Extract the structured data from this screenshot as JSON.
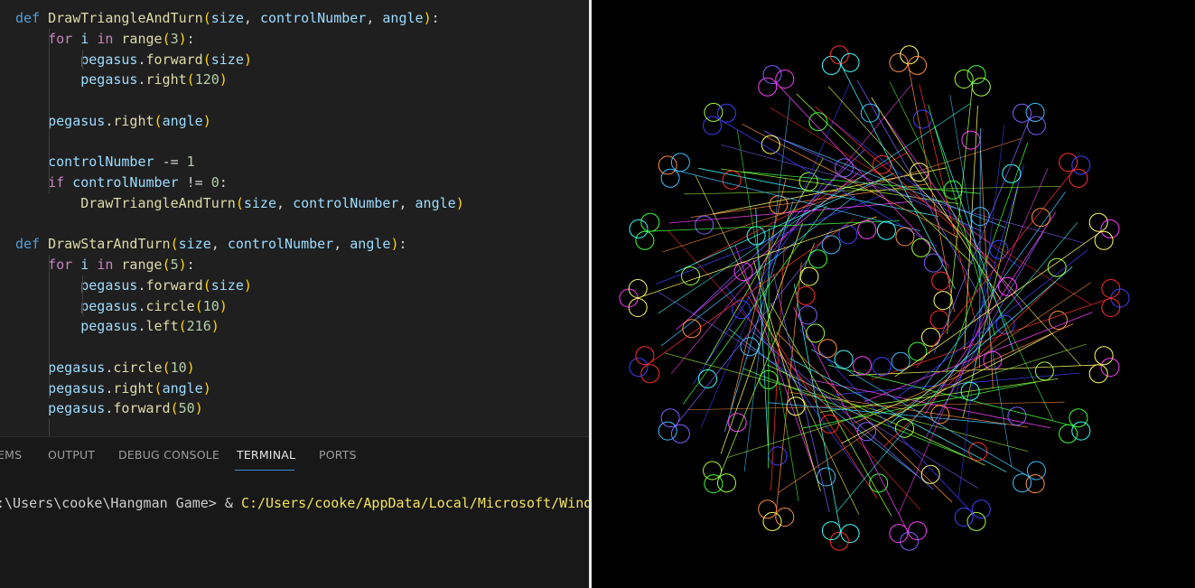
{
  "editor": {
    "lines": [
      [
        {
          "t": "def ",
          "c": "kw-def"
        },
        {
          "t": "DrawTriangleAndTurn",
          "c": "fn"
        },
        {
          "t": "(",
          "c": "br1"
        },
        {
          "t": "size",
          "c": "var"
        },
        {
          "t": ", ",
          "c": "pn"
        },
        {
          "t": "controlNumber",
          "c": "var"
        },
        {
          "t": ", ",
          "c": "pn"
        },
        {
          "t": "angle",
          "c": "var"
        },
        {
          "t": ")",
          "c": "br1"
        },
        {
          "t": ":",
          "c": "pn"
        }
      ],
      [
        {
          "t": "    "
        },
        {
          "t": "for ",
          "c": "kw-ctl"
        },
        {
          "t": "i ",
          "c": "var"
        },
        {
          "t": "in ",
          "c": "kw-ctl"
        },
        {
          "t": "range",
          "c": "fn"
        },
        {
          "t": "(",
          "c": "br1"
        },
        {
          "t": "3",
          "c": "num"
        },
        {
          "t": ")",
          "c": "br1"
        },
        {
          "t": ":",
          "c": "pn"
        }
      ],
      [
        {
          "t": "        "
        },
        {
          "t": "pegasus",
          "c": "var"
        },
        {
          "t": ".",
          "c": "pn"
        },
        {
          "t": "forward",
          "c": "fn"
        },
        {
          "t": "(",
          "c": "br1"
        },
        {
          "t": "size",
          "c": "var"
        },
        {
          "t": ")",
          "c": "br1"
        }
      ],
      [
        {
          "t": "        "
        },
        {
          "t": "pegasus",
          "c": "var"
        },
        {
          "t": ".",
          "c": "pn"
        },
        {
          "t": "right",
          "c": "fn"
        },
        {
          "t": "(",
          "c": "br1"
        },
        {
          "t": "120",
          "c": "num"
        },
        {
          "t": ")",
          "c": "br1"
        }
      ],
      [],
      [
        {
          "t": "    "
        },
        {
          "t": "pegasus",
          "c": "var"
        },
        {
          "t": ".",
          "c": "pn"
        },
        {
          "t": "right",
          "c": "fn"
        },
        {
          "t": "(",
          "c": "br1"
        },
        {
          "t": "angle",
          "c": "var"
        },
        {
          "t": ")",
          "c": "br1"
        }
      ],
      [],
      [
        {
          "t": "    "
        },
        {
          "t": "controlNumber ",
          "c": "var"
        },
        {
          "t": "-= ",
          "c": "op"
        },
        {
          "t": "1",
          "c": "num"
        }
      ],
      [
        {
          "t": "    "
        },
        {
          "t": "if ",
          "c": "kw-ctl"
        },
        {
          "t": "controlNumber ",
          "c": "var"
        },
        {
          "t": "!= ",
          "c": "op"
        },
        {
          "t": "0",
          "c": "num"
        },
        {
          "t": ":",
          "c": "pn"
        }
      ],
      [
        {
          "t": "        "
        },
        {
          "t": "DrawTriangleAndTurn",
          "c": "fn"
        },
        {
          "t": "(",
          "c": "br1"
        },
        {
          "t": "size",
          "c": "var"
        },
        {
          "t": ", ",
          "c": "pn"
        },
        {
          "t": "controlNumber",
          "c": "var"
        },
        {
          "t": ", ",
          "c": "pn"
        },
        {
          "t": "angle",
          "c": "var"
        },
        {
          "t": ")",
          "c": "br1"
        }
      ],
      [],
      [
        {
          "t": "def ",
          "c": "kw-def"
        },
        {
          "t": "DrawStarAndTurn",
          "c": "fn"
        },
        {
          "t": "(",
          "c": "br1"
        },
        {
          "t": "size",
          "c": "var"
        },
        {
          "t": ", ",
          "c": "pn"
        },
        {
          "t": "controlNumber",
          "c": "var"
        },
        {
          "t": ", ",
          "c": "pn"
        },
        {
          "t": "angle",
          "c": "var"
        },
        {
          "t": ")",
          "c": "br1"
        },
        {
          "t": ":",
          "c": "pn"
        }
      ],
      [
        {
          "t": "    "
        },
        {
          "t": "for ",
          "c": "kw-ctl"
        },
        {
          "t": "i ",
          "c": "var"
        },
        {
          "t": "in ",
          "c": "kw-ctl"
        },
        {
          "t": "range",
          "c": "fn"
        },
        {
          "t": "(",
          "c": "br1"
        },
        {
          "t": "5",
          "c": "num"
        },
        {
          "t": ")",
          "c": "br1"
        },
        {
          "t": ":",
          "c": "pn"
        }
      ],
      [
        {
          "t": "        "
        },
        {
          "t": "pegasus",
          "c": "var"
        },
        {
          "t": ".",
          "c": "pn"
        },
        {
          "t": "forward",
          "c": "fn"
        },
        {
          "t": "(",
          "c": "br1"
        },
        {
          "t": "size",
          "c": "var"
        },
        {
          "t": ")",
          "c": "br1"
        }
      ],
      [
        {
          "t": "        "
        },
        {
          "t": "pegasus",
          "c": "var"
        },
        {
          "t": ".",
          "c": "pn"
        },
        {
          "t": "circle",
          "c": "fn"
        },
        {
          "t": "(",
          "c": "br1"
        },
        {
          "t": "10",
          "c": "num"
        },
        {
          "t": ")",
          "c": "br1"
        }
      ],
      [
        {
          "t": "        "
        },
        {
          "t": "pegasus",
          "c": "var"
        },
        {
          "t": ".",
          "c": "pn"
        },
        {
          "t": "left",
          "c": "fn"
        },
        {
          "t": "(",
          "c": "br1"
        },
        {
          "t": "216",
          "c": "num"
        },
        {
          "t": ")",
          "c": "br1"
        }
      ],
      [],
      [
        {
          "t": "    "
        },
        {
          "t": "pegasus",
          "c": "var"
        },
        {
          "t": ".",
          "c": "pn"
        },
        {
          "t": "circle",
          "c": "fn"
        },
        {
          "t": "(",
          "c": "br1"
        },
        {
          "t": "10",
          "c": "num"
        },
        {
          "t": ")",
          "c": "br1"
        }
      ],
      [
        {
          "t": "    "
        },
        {
          "t": "pegasus",
          "c": "var"
        },
        {
          "t": ".",
          "c": "pn"
        },
        {
          "t": "right",
          "c": "fn"
        },
        {
          "t": "(",
          "c": "br1"
        },
        {
          "t": "angle",
          "c": "var"
        },
        {
          "t": ")",
          "c": "br1"
        }
      ],
      [
        {
          "t": "    "
        },
        {
          "t": "pegasus",
          "c": "var"
        },
        {
          "t": ".",
          "c": "pn"
        },
        {
          "t": "forward",
          "c": "fn"
        },
        {
          "t": "(",
          "c": "br1"
        },
        {
          "t": "50",
          "c": "num"
        },
        {
          "t": ")",
          "c": "br1"
        }
      ]
    ]
  },
  "panel": {
    "tabs": [
      {
        "label": "EMS",
        "active": false
      },
      {
        "label": "OUTPUT",
        "active": false
      },
      {
        "label": "DEBUG CONSOLE",
        "active": false
      },
      {
        "label": "TERMINAL",
        "active": true
      },
      {
        "label": "PORTS",
        "active": false
      }
    ],
    "terminal": {
      "prompt": ":\\Users\\cooke\\Hangman Game> & ",
      "path": "C:/Users/cooke/AppData/Local/Microsoft/Wind"
    }
  },
  "turtle": {
    "background": "#000000",
    "colors": [
      "#ff3030",
      "#ffff66",
      "#40ff40",
      "#40c0ff",
      "#4040ff",
      "#ff40ff",
      "#40ffff",
      "#ff9040",
      "#a0ff40",
      "#8060ff"
    ]
  }
}
